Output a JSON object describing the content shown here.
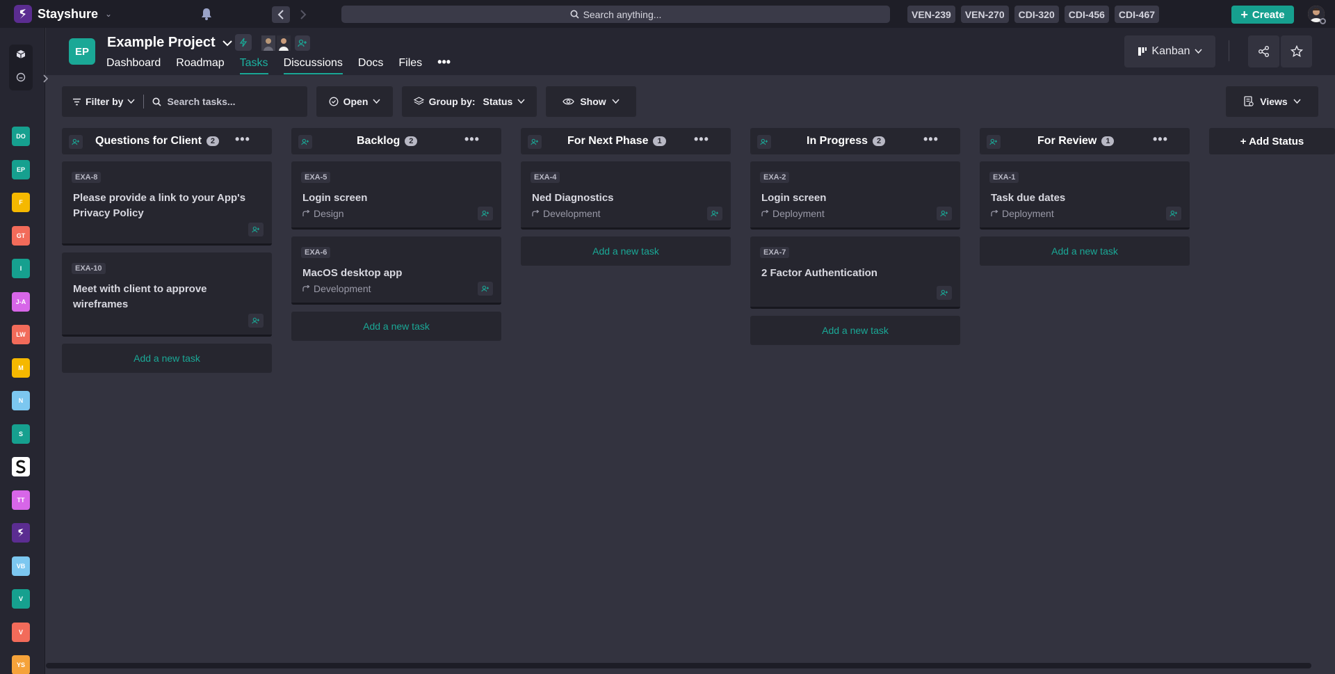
{
  "app": {
    "name": "Stayshure"
  },
  "search": {
    "placeholder": "Search anything..."
  },
  "recent_issues": [
    "VEN-239",
    "VEN-270",
    "CDI-320",
    "CDI-456",
    "CDI-467"
  ],
  "create_label": "Create",
  "sidebar": {
    "projects": [
      {
        "code": "DO",
        "color": "#16a08f"
      },
      {
        "code": "EP",
        "color": "#16a08f",
        "active": true
      },
      {
        "code": "F",
        "color": "#f5b800"
      },
      {
        "code": "GT",
        "color": "#f26b5a"
      },
      {
        "code": "I",
        "color": "#16a08f"
      },
      {
        "code": "J-A",
        "color": "#d766e8"
      },
      {
        "code": "LW",
        "color": "#f26b5a"
      },
      {
        "code": "M",
        "color": "#f5b800"
      },
      {
        "code": "N",
        "color": "#7cc7f0"
      },
      {
        "code": "S",
        "color": "#16a08f"
      },
      {
        "code": "S-logo",
        "color": "#ffffff"
      },
      {
        "code": "TT",
        "color": "#d766e8"
      },
      {
        "code": "S-brand",
        "color": "#5b2d91"
      },
      {
        "code": "VB",
        "color": "#7cc7f0"
      },
      {
        "code": "V",
        "color": "#16a08f"
      },
      {
        "code": "V",
        "color": "#f26b5a"
      },
      {
        "code": "YS",
        "color": "#f5a23a"
      }
    ]
  },
  "project": {
    "badge": "EP",
    "title": "Example Project",
    "tabs": [
      "Dashboard",
      "Roadmap",
      "Tasks",
      "Discussions",
      "Docs",
      "Files"
    ],
    "active_tab": "Tasks",
    "view_label": "Kanban"
  },
  "toolbar": {
    "filter_label": "Filter by",
    "search_placeholder": "Search tasks...",
    "status_filter": "Open",
    "group_by_label": "Group by:",
    "group_by_value": "Status",
    "show_label": "Show",
    "views_label": "Views"
  },
  "columns": [
    {
      "title": "Questions for Client",
      "count": "2",
      "cards": [
        {
          "key": "EXA-8",
          "title": "Please provide a link to your App's Privacy Policy",
          "parent": ""
        },
        {
          "key": "EXA-10",
          "title": "Meet with client to approve wireframes",
          "parent": ""
        }
      ]
    },
    {
      "title": "Backlog",
      "count": "2",
      "cards": [
        {
          "key": "EXA-5",
          "title": "Login screen",
          "parent": "Design"
        },
        {
          "key": "EXA-6",
          "title": "MacOS desktop app",
          "parent": "Development"
        }
      ]
    },
    {
      "title": "For Next Phase",
      "count": "1",
      "cards": [
        {
          "key": "EXA-4",
          "title": "Ned Diagnostics",
          "parent": "Development"
        }
      ]
    },
    {
      "title": "In Progress",
      "count": "2",
      "cards": [
        {
          "key": "EXA-2",
          "title": "Login screen",
          "parent": "Deployment"
        },
        {
          "key": "EXA-7",
          "title": "2 Factor Authentication",
          "parent": ""
        }
      ]
    },
    {
      "title": "For Review",
      "count": "1",
      "cards": [
        {
          "key": "EXA-1",
          "title": "Task due dates",
          "parent": "Deployment"
        }
      ]
    }
  ],
  "add_task_label": "Add a new task",
  "add_status_label": "+ Add Status"
}
